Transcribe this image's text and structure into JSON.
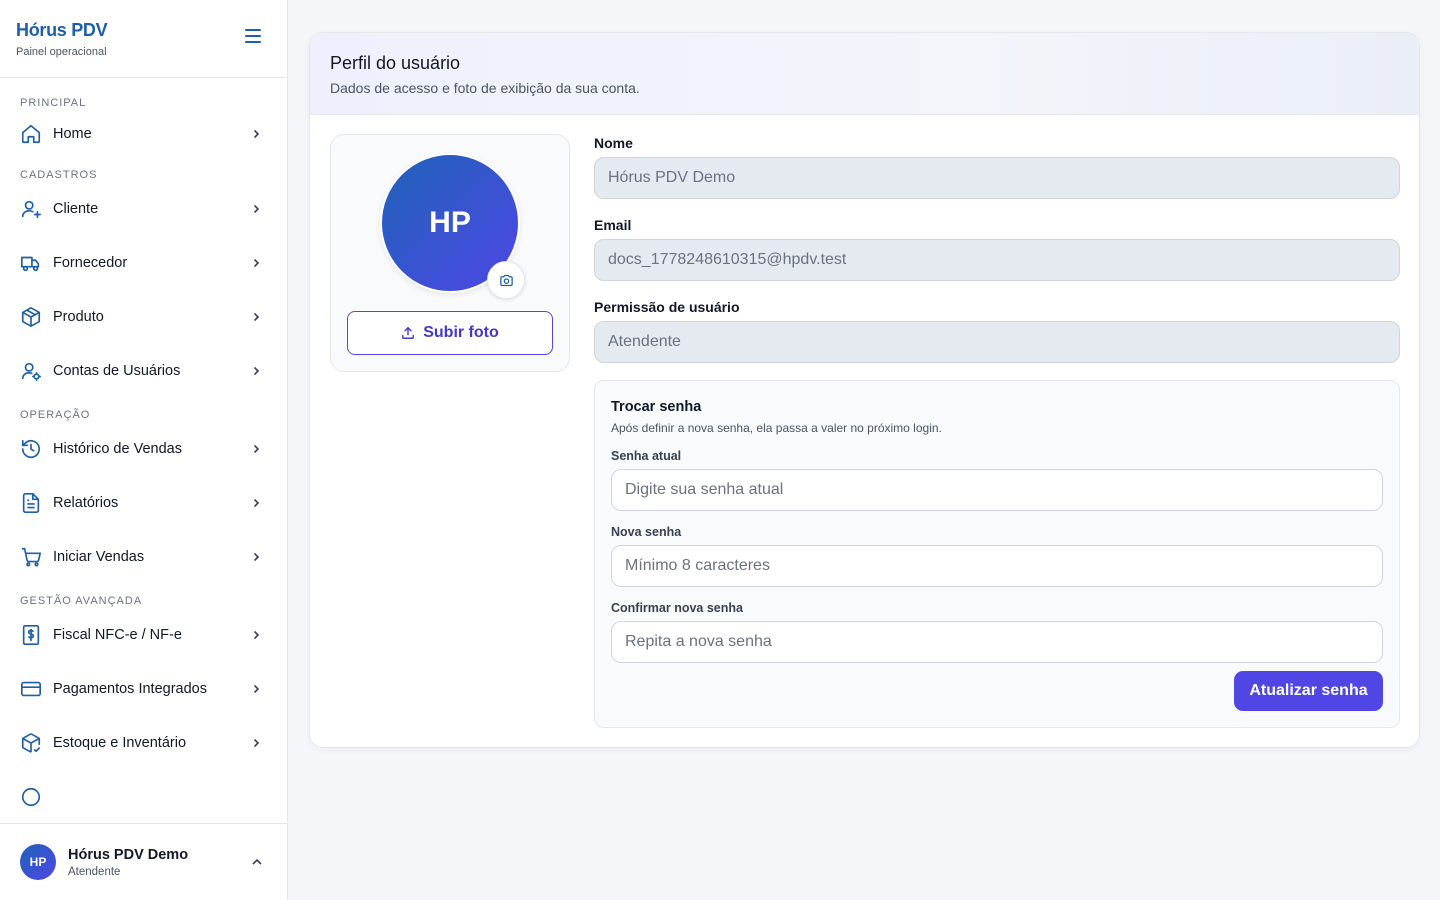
{
  "brand": {
    "title": "Hórus PDV",
    "subtitle": "Painel operacional"
  },
  "nav": {
    "sections": {
      "principal": "PRINCIPAL",
      "cadastros": "CADASTROS",
      "operacao": "OPERAÇÃO",
      "gestao": "GESTÃO AVANÇADA"
    },
    "items": {
      "home": "Home",
      "cliente": "Cliente",
      "fornecedor": "Fornecedor",
      "produto": "Produto",
      "contas": "Contas de Usuários",
      "historico": "Histórico de Vendas",
      "relatorios": "Relatórios",
      "iniciar": "Iniciar Vendas",
      "fiscal": "Fiscal NFC-e / NF-e",
      "pagamentos": "Pagamentos Integrados",
      "estoque": "Estoque e Inventário"
    }
  },
  "user": {
    "initials": "HP",
    "name": "Hórus PDV Demo",
    "role": "Atendente"
  },
  "profile": {
    "title": "Perfil do usuário",
    "subtitle": "Dados de acesso e foto de exibição da sua conta.",
    "avatar_initials": "HP",
    "upload_label": "Subir foto",
    "fields": {
      "name_label": "Nome",
      "name_value": "Hórus PDV Demo",
      "email_label": "Email",
      "email_value": "docs_1778248610315@hpdv.test",
      "permission_label": "Permissão de usuário",
      "permission_value": "Atendente"
    },
    "password": {
      "title": "Trocar senha",
      "subtitle": "Após definir a nova senha, ela passa a valer no próximo login.",
      "current_label": "Senha atual",
      "current_placeholder": "Digite sua senha atual",
      "new_label": "Nova senha",
      "new_placeholder": "Mínimo 8 caracteres",
      "confirm_label": "Confirmar nova senha",
      "confirm_placeholder": "Repita a nova senha",
      "submit_label": "Atualizar senha"
    }
  },
  "colors": {
    "brand": "#1d5fa8",
    "accent": "#4f46e5",
    "background": "#f4f6fa"
  }
}
